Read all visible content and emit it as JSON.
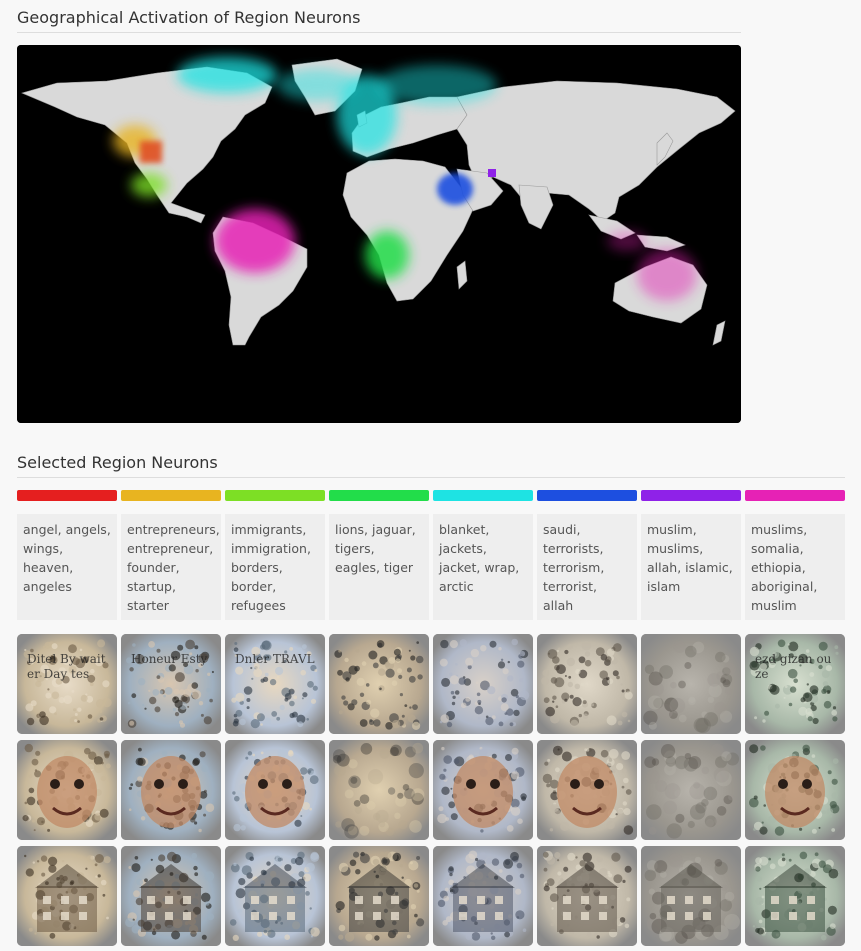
{
  "map_section": {
    "title": "Geographical Activation of Region Neurons"
  },
  "neurons_section": {
    "title": "Selected Region Neurons",
    "neurons": [
      {
        "color": "#e51f1f",
        "label": "angel, angels, wings, heaven, angeles"
      },
      {
        "color": "#e8b420",
        "label": "entrepreneurs, entrepreneur, founder, startup, starter"
      },
      {
        "color": "#7ddf25",
        "label": "immigrants, immigration, borders, border, refugees"
      },
      {
        "color": "#22dd4a",
        "label": "lions, jaguar, tigers, eagles, tiger"
      },
      {
        "color": "#1ee3e3",
        "label": "blanket, jackets, jacket, wrap, arctic"
      },
      {
        "color": "#1d4fe0",
        "label": "saudi, terrorists, terrorism, terrorist, allah"
      },
      {
        "color": "#8f22e8",
        "label": "muslim, muslims, allah, islamic, islam"
      },
      {
        "color": "#e622b5",
        "label": "muslims, somalia, ethiopia, aboriginal, muslim"
      }
    ]
  },
  "feature_visualizations": {
    "rows": [
      "text",
      "faces",
      "buildings"
    ],
    "thumb_text": [
      "Ditel By waiter Day tes",
      "Honeur Esty",
      "Dnler TRAVL",
      "",
      "",
      "",
      "",
      "ezd gizan ouze"
    ]
  }
}
